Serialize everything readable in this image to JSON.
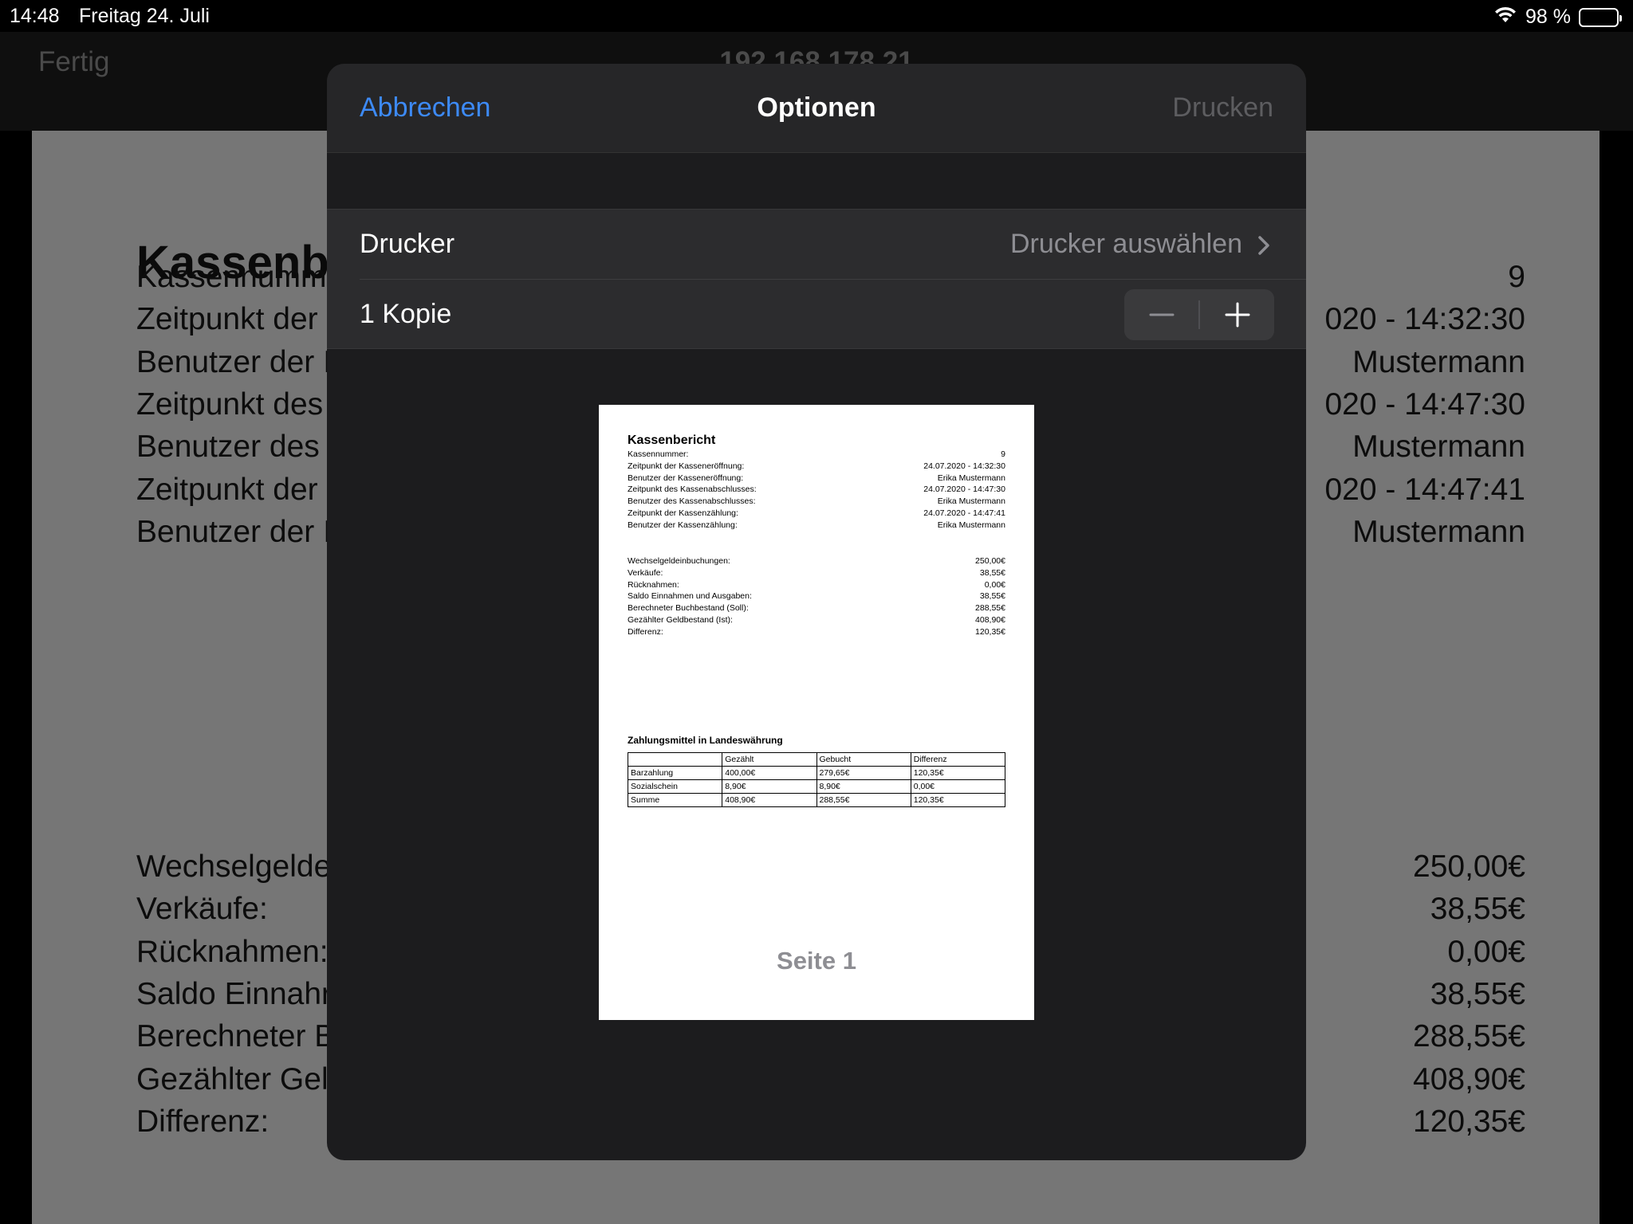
{
  "status_bar": {
    "time": "14:48",
    "date": "Freitag 24. Juli",
    "battery": "98 %",
    "battery_level": 0.98
  },
  "background": {
    "nav": {
      "done_label": "Fertig",
      "title": "192.168.178.21"
    },
    "document": {
      "title": "Kassenbe",
      "rows_top": [
        {
          "label": "Kassennumm",
          "value": "9"
        },
        {
          "label": "Zeitpunkt der",
          "value": "020 - 14:32:30"
        },
        {
          "label": "Benutzer der I",
          "value": "Mustermann"
        },
        {
          "label": "Zeitpunkt des",
          "value": "020 - 14:47:30"
        },
        {
          "label": "Benutzer des",
          "value": "Mustermann"
        },
        {
          "label": "Zeitpunkt der",
          "value": "020 - 14:47:41"
        },
        {
          "label": "Benutzer der I",
          "value": "Mustermann"
        }
      ],
      "rows_bottom": [
        {
          "label": "Wechselgelde",
          "value": "250,00€"
        },
        {
          "label": "Verkäufe:",
          "value": "38,55€"
        },
        {
          "label": "Rücknahmen:",
          "value": "0,00€"
        },
        {
          "label": "Saldo Einnahr",
          "value": "38,55€"
        },
        {
          "label": "Berechneter B",
          "value": "288,55€"
        },
        {
          "label": "Gezählter Gel",
          "value": "408,90€"
        },
        {
          "label": "Differenz:",
          "value": "120,35€"
        }
      ]
    }
  },
  "sheet": {
    "cancel_label": "Abbrechen",
    "title": "Optionen",
    "print_label": "Drucken",
    "printer": {
      "label": "Drucker",
      "value": "Drucker auswählen"
    },
    "copies": {
      "label": "1 Kopie"
    },
    "preview": {
      "title": "Kassenbericht",
      "rows_top": [
        {
          "label": "Kassennummer:",
          "value": "9"
        },
        {
          "label": "Zeitpunkt der Kasseneröffnung:",
          "value": "24.07.2020 - 14:32:30"
        },
        {
          "label": "Benutzer der Kasseneröffnung:",
          "value": "Erika Mustermann"
        },
        {
          "label": "Zeitpunkt des Kassenabschlusses:",
          "value": "24.07.2020 - 14:47:30"
        },
        {
          "label": "Benutzer des Kassenabschlusses:",
          "value": "Erika Mustermann"
        },
        {
          "label": "Zeitpunkt der Kassenzählung:",
          "value": "24.07.2020 - 14:47:41"
        },
        {
          "label": "Benutzer der Kassenzählung:",
          "value": "Erika Mustermann"
        }
      ],
      "rows_bottom": [
        {
          "label": "Wechselgeldeinbuchungen:",
          "value": "250,00€"
        },
        {
          "label": "Verkäufe:",
          "value": "38,55€"
        },
        {
          "label": "Rücknahmen:",
          "value": "0,00€"
        },
        {
          "label": "Saldo Einnahmen und Ausgaben:",
          "value": "38,55€"
        },
        {
          "label": "Berechneter Buchbestand (Soll):",
          "value": "288,55€"
        },
        {
          "label": "Gezählter Geldbestand (Ist):",
          "value": "408,90€"
        },
        {
          "label": "Differenz:",
          "value": "120,35€"
        }
      ],
      "table_title": "Zahlungsmittel in Landeswährung",
      "table": {
        "headers": [
          "",
          "Gezählt",
          "Gebucht",
          "Differenz"
        ],
        "rows": [
          [
            "Barzahlung",
            "400,00€",
            "279,65€",
            "120,35€"
          ],
          [
            "Sozialschein",
            "8,90€",
            "8,90€",
            "0,00€"
          ],
          [
            "Summe",
            "408,90€",
            "288,55€",
            "120,35€"
          ]
        ]
      },
      "footer": "Seite 1"
    }
  },
  "colors": {
    "accent": "#3d8af7",
    "sheet_bg": "#1c1c1e",
    "disabled_text": "#5d5d60"
  }
}
